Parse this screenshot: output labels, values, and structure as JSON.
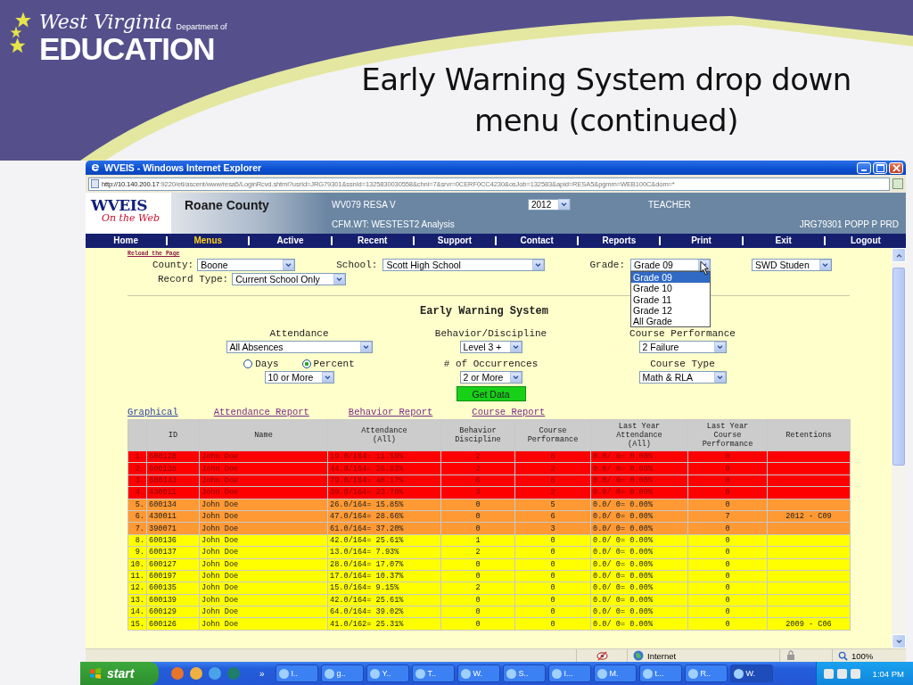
{
  "slide": {
    "title": "Early Warning System drop down menu (continued)",
    "logo_script": "West Virginia",
    "logo_dept": "Department of",
    "logo_main": "EDUCATION"
  },
  "window": {
    "title": "WVEIS - Windows Internet Explorer",
    "address_host": "http://10.140.200.17",
    "address_rest": ":9220/etl/ascent/www/resa5/LoginRcvd.shtml?usrId=JRG79301&ssnId=1325830030558&chnl=7&srvr=0CERF0CC4230&osJob=132583&apid=RESA5&pgmm=WEB100C&dom=*"
  },
  "site": {
    "logo_top": "WVEIS",
    "logo_bottom": "On the Web",
    "county": "Roane County",
    "org": "WV079 RESA V",
    "app": "CFM.WT: WESTEST2 Analysis",
    "year": "2012",
    "role": "TEACHER",
    "user": "JRG79301 POPP P PRD"
  },
  "nav": [
    {
      "label": "Home",
      "selected": false
    },
    {
      "label": "Menus",
      "selected": true
    },
    {
      "label": "Active",
      "selected": false
    },
    {
      "label": "Recent",
      "selected": false
    },
    {
      "label": "Support",
      "selected": false
    },
    {
      "label": "Contact",
      "selected": false
    },
    {
      "label": "Reports",
      "selected": false
    },
    {
      "label": "Print",
      "selected": false
    },
    {
      "label": "Exit",
      "selected": false
    },
    {
      "label": "Logout",
      "selected": false
    }
  ],
  "filters": {
    "reload": "Reload the Page",
    "county_label": "County:",
    "county": "Boone",
    "school_label": "School:",
    "school": "Scott High School",
    "grade_label": "Grade:",
    "grade": "Grade 09",
    "swd": "SWD Studen",
    "record_type_label": "Record Type:",
    "record_type": "Current School Only",
    "grade_options": [
      {
        "label": "Grade 09",
        "selected": true
      },
      {
        "label": "Grade 10",
        "selected": false
      },
      {
        "label": "Grade 11",
        "selected": false
      },
      {
        "label": "Grade 12",
        "selected": false
      },
      {
        "label": "All Grade",
        "selected": false
      }
    ]
  },
  "ews": {
    "title": "Early Warning System",
    "attendance_label": "Attendance",
    "attendance": "All Absences",
    "units": [
      {
        "label": "Days",
        "selected": false
      },
      {
        "label": "Percent",
        "selected": true
      }
    ],
    "attendance_threshold": "10 or More",
    "behavior_label": "Behavior/Discipline",
    "behavior": "Level 3 +",
    "occurrences_label": "# of Occurrences",
    "occurrences": "2 or More",
    "course_label": "Course Performance",
    "course": "2 Failure",
    "course_type_label": "Course Type",
    "course_type": "Math & RLA",
    "button": "Get Data"
  },
  "report_links": [
    {
      "label": "Graphical",
      "visited": false
    },
    {
      "label": "Attendance Report",
      "visited": true
    },
    {
      "label": "Behavior Report",
      "visited": true
    },
    {
      "label": "Course Report",
      "visited": true
    }
  ],
  "table": {
    "columns": [
      "ID",
      "Name",
      "Attendance\n(All)",
      "Behavior\nDiscipline",
      "Course\nPerformance",
      "Last Year\nAttendance\n(All)",
      "Last Year\nCourse\nPerformance",
      "Retentions"
    ],
    "rows": [
      {
        "n": "1.",
        "id": "600128",
        "name": "John Doe",
        "attendance": "19.0/164= 11.59%",
        "behavior": "2",
        "course": "8",
        "ly_attendance": "0.0/ 0= 0.00%",
        "ly_course": "0",
        "kind": "high",
        "color": "#ff0000"
      },
      {
        "n": "2.",
        "id": "600138",
        "name": "John Doe",
        "attendance": "44.0/164= 26.83%",
        "behavior": "2",
        "course": "2",
        "ly_attendance": "0.0/ 0= 0.00%",
        "ly_course": "0",
        "kind": "high",
        "color": "#ff0000"
      },
      {
        "n": "3.",
        "id": "600143",
        "name": "John Doe",
        "attendance": "79.0/164= 48.17%",
        "behavior": "6",
        "course": "8",
        "ly_attendance": "0.0/ 0= 0.00%",
        "ly_course": "0",
        "kind": "high",
        "color": "#ff0000"
      },
      {
        "n": "4.",
        "id": "430011",
        "name": "John Doe",
        "attendance": "39.0/164= 23.78%",
        "behavior": "3",
        "course": "2",
        "ly_attendance": "0.0/ 0= 0.00%",
        "ly_course": "0",
        "kind": "high",
        "color": "#ff0000"
      },
      {
        "n": "5.",
        "id": "600134",
        "name": "John Doe",
        "attendance": "26.0/164= 15.85%",
        "behavior": "0",
        "course": "5",
        "ly_attendance": "0.0/ 0= 0.00%",
        "ly_course": "0",
        "kind": "medium",
        "color": "#ff9933"
      },
      {
        "n": "6.",
        "id": "430011",
        "name": "John Doe",
        "attendance": "47.0/164= 28.66%",
        "behavior": "0",
        "course": "6",
        "ly_attendance": "0.0/ 0= 0.00%",
        "ly_course": "7",
        "retentions": "2012 - C09",
        "kind": "medium",
        "color": "#ff9933"
      },
      {
        "n": "7.",
        "id": "390071",
        "name": "John Doe",
        "attendance": "61.0/164= 37.20%",
        "behavior": "0",
        "course": "3",
        "ly_attendance": "0.0/ 0= 0.00%",
        "ly_course": "0",
        "kind": "medium",
        "color": "#ff9933"
      },
      {
        "n": "8.",
        "id": "600136",
        "name": "John Doe",
        "attendance": "42.0/164= 25.61%",
        "behavior": "1",
        "course": "0",
        "ly_attendance": "0.0/ 0= 0.00%",
        "ly_course": "0",
        "kind": "low",
        "color": "#ffff00"
      },
      {
        "n": "9.",
        "id": "600137",
        "name": "John Doe",
        "attendance": "13.0/164= 7.93%",
        "behavior": "2",
        "course": "0",
        "ly_attendance": "0.0/ 0= 0.00%",
        "ly_course": "0",
        "kind": "low",
        "color": "#ffff00"
      },
      {
        "n": "10.",
        "id": "600127",
        "name": "John Doe",
        "attendance": "28.0/164= 17.07%",
        "behavior": "0",
        "course": "0",
        "ly_attendance": "0.0/ 0= 0.00%",
        "ly_course": "0",
        "kind": "low",
        "color": "#ffff00"
      },
      {
        "n": "11.",
        "id": "600197",
        "name": "John Doe",
        "attendance": "17.0/164= 10.37%",
        "behavior": "0",
        "course": "0",
        "ly_attendance": "0.0/ 0= 0.00%",
        "ly_course": "0",
        "kind": "low",
        "color": "#ffff00"
      },
      {
        "n": "12.",
        "id": "600135",
        "name": "John Doe",
        "attendance": "15.0/164= 9.15%",
        "behavior": "2",
        "course": "0",
        "ly_attendance": "0.0/ 0= 0.00%",
        "ly_course": "0",
        "kind": "low",
        "color": "#ffff00"
      },
      {
        "n": "13.",
        "id": "600139",
        "name": "John Doe",
        "attendance": "42.0/164= 25.61%",
        "behavior": "0",
        "course": "0",
        "ly_attendance": "0.0/ 0= 0.00%",
        "ly_course": "0",
        "kind": "low",
        "color": "#ffff00"
      },
      {
        "n": "14.",
        "id": "600129",
        "name": "John Doe",
        "attendance": "64.0/164= 39.02%",
        "behavior": "0",
        "course": "0",
        "ly_attendance": "0.0/ 0= 0.00%",
        "ly_course": "0",
        "kind": "low",
        "color": "#ffff00"
      },
      {
        "n": "15.",
        "id": "600126",
        "name": "John Doe",
        "attendance": "41.0/162= 25.31%",
        "behavior": "0",
        "course": "0",
        "ly_attendance": "0.0/ 0= 0.00%",
        "ly_course": "0",
        "retentions": "2009 - C06",
        "kind": "low",
        "color": "#ffff00"
      }
    ]
  },
  "status_bar": {
    "zone": "Internet",
    "zoom": "100%"
  },
  "taskbar": {
    "start": "start",
    "more": "»",
    "tasks": [
      {
        "label": "I..",
        "selected": false
      },
      {
        "label": "g..",
        "selected": false
      },
      {
        "label": "Y..",
        "selected": false
      },
      {
        "label": "T..",
        "selected": false
      },
      {
        "label": "W.",
        "selected": false
      },
      {
        "label": "S..",
        "selected": false
      },
      {
        "label": "I...",
        "selected": false
      },
      {
        "label": "M.",
        "selected": false
      },
      {
        "label": "t...",
        "selected": false
      },
      {
        "label": "R..",
        "selected": false
      },
      {
        "label": "W.",
        "selected": true
      }
    ],
    "clock": "1:04 PM"
  }
}
